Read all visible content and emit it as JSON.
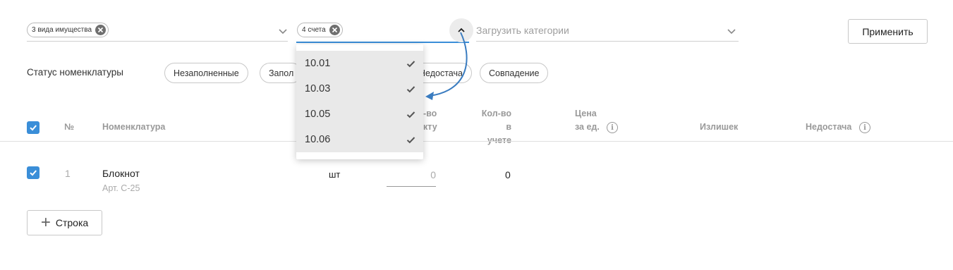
{
  "filters": {
    "property_chip": "3 вида имущества",
    "accounts_chip": "4 счета",
    "categories_placeholder": "Загрузить категории",
    "apply_label": "Применить"
  },
  "status": {
    "label": "Статус номенклатуры",
    "pills": [
      "Незаполненные",
      "Запол",
      "Недостача",
      "Совпадение"
    ]
  },
  "dropdown": {
    "items": [
      {
        "label": "10.01",
        "checked": true
      },
      {
        "label": "10.03",
        "checked": true
      },
      {
        "label": "10.05",
        "checked": true
      },
      {
        "label": "10.06",
        "checked": true
      }
    ]
  },
  "table": {
    "headers": {
      "number": "№",
      "item": "Номенклатура",
      "qty_fact_1": "-во",
      "qty_fact_2": "кту",
      "qty_account_1": "Кол-во",
      "qty_account_2": "в учете",
      "price_1": "Цена",
      "price_2": "за ед.",
      "surplus": "Излишек",
      "shortage": "Недостача"
    },
    "rows": [
      {
        "number": "1",
        "name": "Блокнот",
        "article": "Арт. С-25",
        "unit": "шт",
        "qty_fact": "0",
        "qty_account": "0"
      }
    ],
    "add_row_label": "Строка"
  },
  "colors": {
    "accent": "#3a8ed8",
    "arrow": "#3a7cc0"
  }
}
